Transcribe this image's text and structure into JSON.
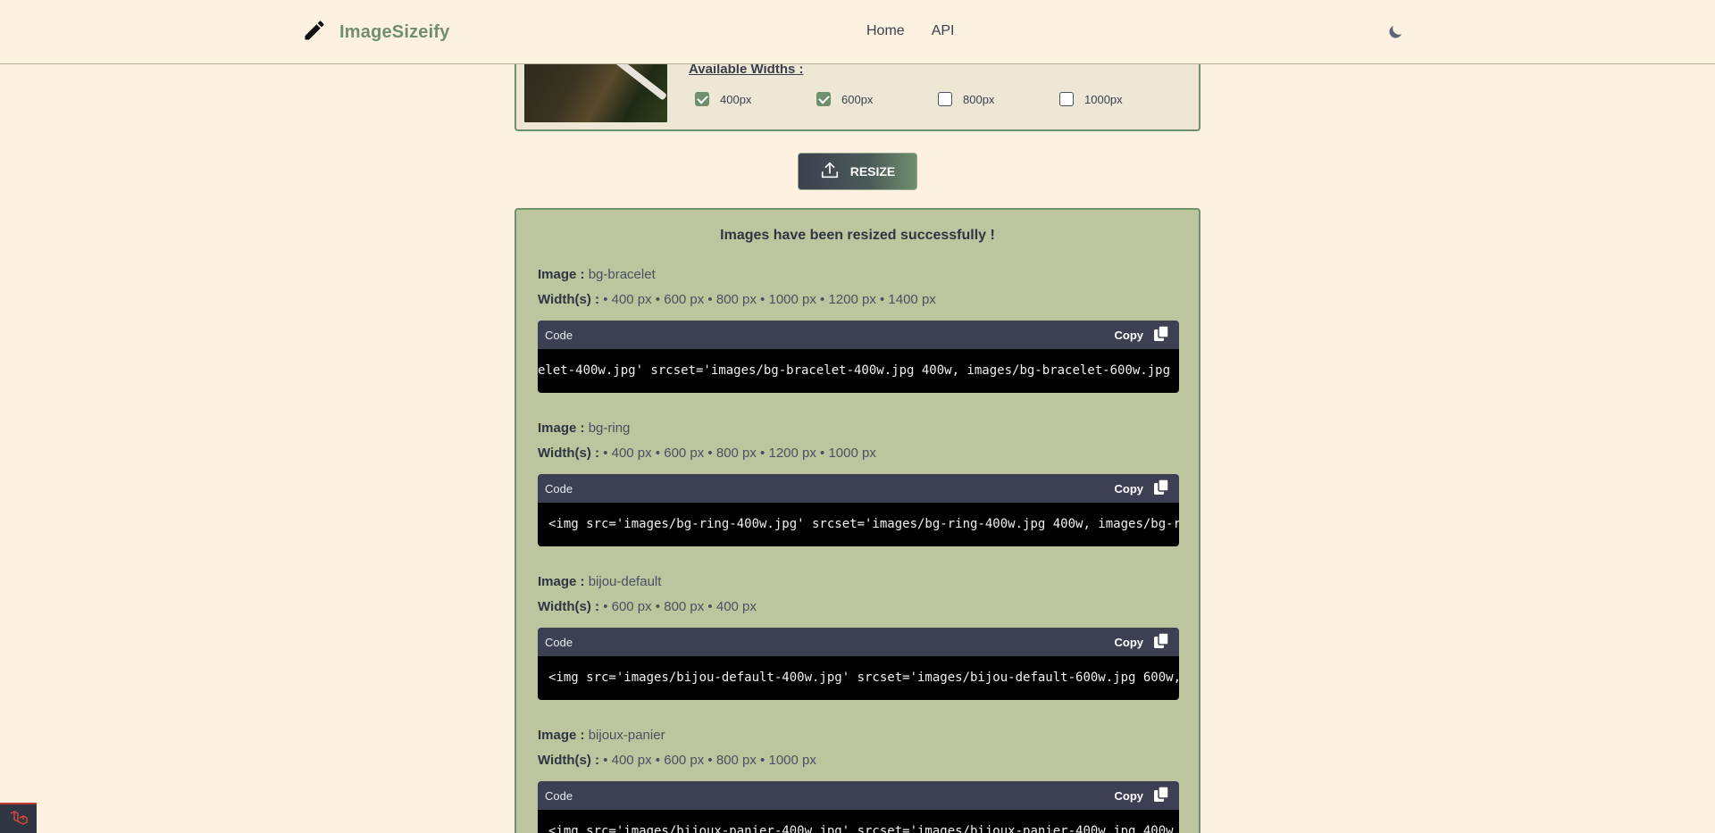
{
  "header": {
    "brand": "ImageSizeify",
    "nav": [
      "Home",
      "API"
    ],
    "logo_icon": "pencil-icon",
    "theme_icon": "moon-icon"
  },
  "upload": {
    "widths_label": "Available Widths :",
    "options": [
      {
        "label": "400px",
        "checked": true
      },
      {
        "label": "600px",
        "checked": true
      },
      {
        "label": "800px",
        "checked": false
      },
      {
        "label": "1000px",
        "checked": false
      }
    ]
  },
  "resize_button": {
    "label": "RESIZE",
    "icon": "upload-icon"
  },
  "results": {
    "title": "Images have been resized successfully !",
    "image_label": "Image :",
    "widths_label": "Width(s) :",
    "code_label": "Code",
    "copy_label": "Copy",
    "items": [
      {
        "image": "bg-bracelet",
        "widths": "• 400 px • 600 px • 800 px • 1000 px • 1200 px • 1400 px",
        "code": "elet-400w.jpg' srcset='images/bg-bracelet-400w.jpg 400w, images/bg-bracelet-600w.jpg"
      },
      {
        "image": "bg-ring",
        "widths": "• 400 px • 600 px • 800 px • 1200 px • 1000 px",
        "code": "<img src='images/bg-ring-400w.jpg' srcset='images/bg-ring-400w.jpg 400w, images/bg-r"
      },
      {
        "image": "bijou-default",
        "widths": "• 600 px • 800 px • 400 px",
        "code": "<img src='images/bijou-default-400w.jpg' srcset='images/bijou-default-600w.jpg 600w,"
      },
      {
        "image": "bijoux-panier",
        "widths": "• 400 px • 600 px • 800 px • 1000 px",
        "code": "<img src='images/bijoux-panier-400w.jpg' srcset='images/bijoux-panier-400w.jpg 400w,"
      }
    ]
  },
  "colors": {
    "accent": "#6f8f6e",
    "background": "#fdf1e2",
    "result_bg": "#bdc59e",
    "code_head": "#3c4052"
  }
}
